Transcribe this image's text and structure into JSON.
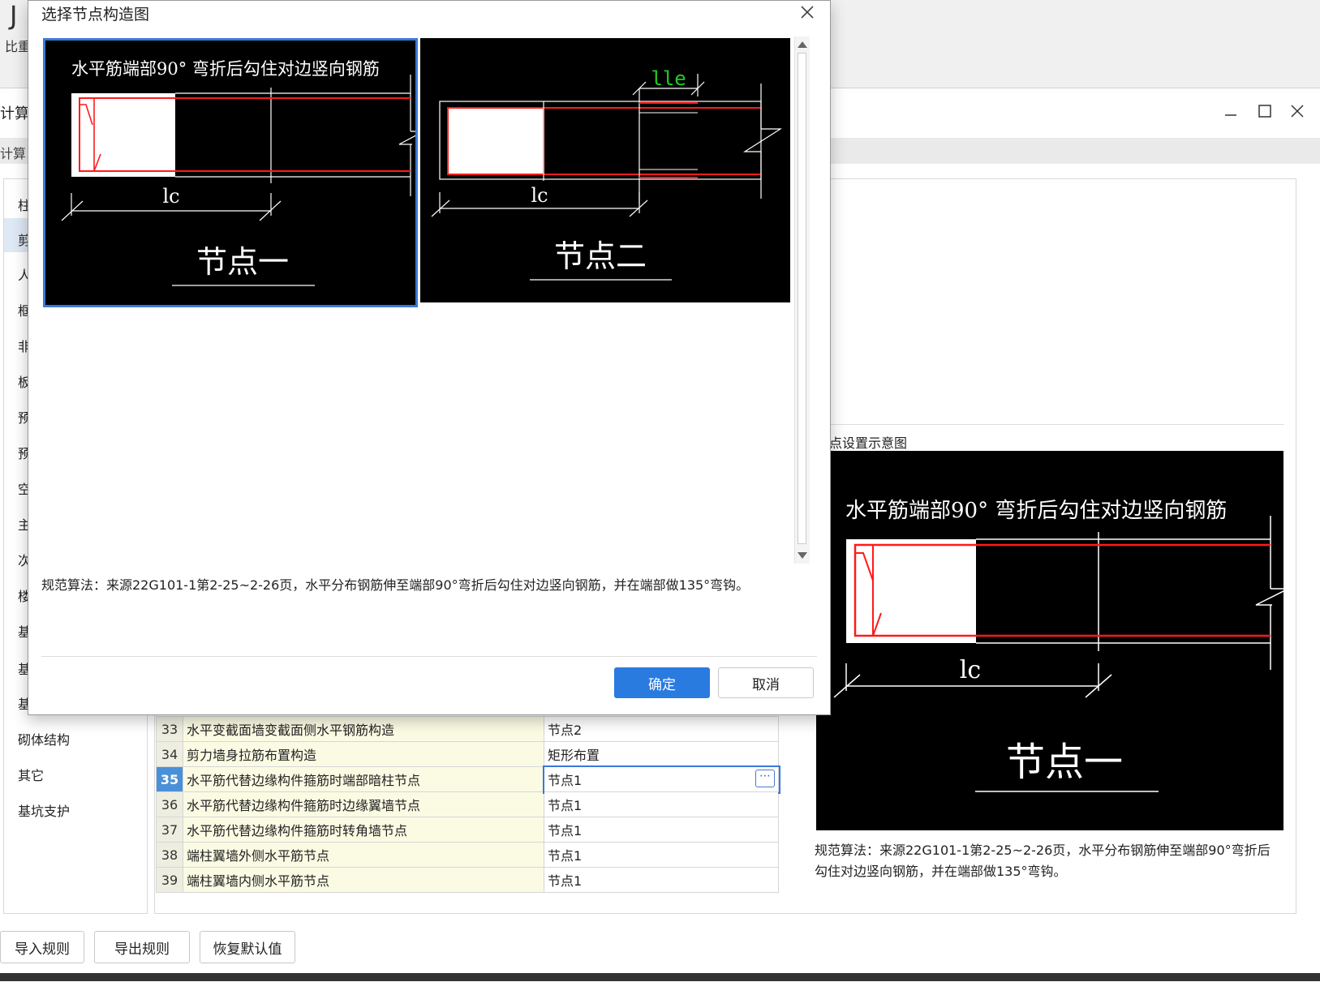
{
  "bg": {
    "app_letter": "J",
    "app_sub": "比重",
    "calc_label": "计算",
    "calc_label2": "计算",
    "left_nav": [
      "柱",
      "剪",
      "人",
      "框",
      "非",
      "板",
      "预",
      "预",
      "空",
      "主",
      "次",
      "楼",
      "基",
      "基",
      "基础人梁",
      "砌体结构",
      "其它",
      "基坑支护"
    ],
    "preview_title": "点设置示意图",
    "preview_desc": "规范算法：来源22G101-1第2-25~2-26页，水平分布钢筋伸至端部90°弯折后勾住对边竖向钢筋，并在端部做135°弯钩。",
    "preview_image": {
      "caption": "水平筋端部90° 弯折后勾住对边竖向钢筋",
      "dim_label": "lc",
      "node_title": "节点一"
    },
    "rows": [
      {
        "num": "33",
        "name": "水平变截面墙变截面侧水平钢筋构造",
        "value": "节点2"
      },
      {
        "num": "34",
        "name": "剪力墙身拉筋布置构造",
        "value": "矩形布置"
      },
      {
        "num": "35",
        "name": "水平筋代替边缘构件箍筋时端部暗柱节点",
        "value": "节点1"
      },
      {
        "num": "36",
        "name": "水平筋代替边缘构件箍筋时边缘翼墙节点",
        "value": "节点1"
      },
      {
        "num": "37",
        "name": "水平筋代替边缘构件箍筋时转角墙节点",
        "value": "节点1"
      },
      {
        "num": "38",
        "name": "端柱翼墙外侧水平筋节点",
        "value": "节点1"
      },
      {
        "num": "39",
        "name": "端柱翼墙内侧水平筋节点",
        "value": "节点1"
      }
    ],
    "selected_row": "35",
    "buttons": {
      "import": "导入规则",
      "export": "导出规则",
      "restore": "恢复默认值"
    }
  },
  "dialog": {
    "title": "选择节点构造图",
    "node1": {
      "caption": "水平筋端部90° 弯折后勾住对边竖向钢筋",
      "dim_label": "lc",
      "node_title": "节点一",
      "selected": true
    },
    "node2": {
      "dim_label": "lc",
      "dim_label_top": "lle",
      "node_title": "节点二"
    },
    "description": "规范算法：来源22G101-1第2-25~2-26页，水平分布钢筋伸至端部90°弯折后勾住对边竖向钢筋，并在端部做135°弯钩。",
    "ok_label": "确定",
    "cancel_label": "取消"
  },
  "colors": {
    "accent": "#2a7be0",
    "rebar": "#ff1a1a",
    "green_dim": "#22cc22",
    "select_border": "#3a78d8"
  }
}
